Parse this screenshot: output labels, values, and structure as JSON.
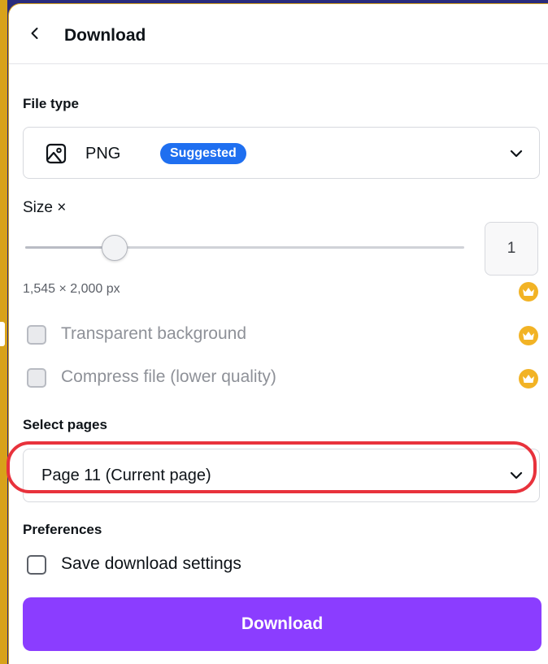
{
  "header": {
    "back_icon": "chevron-left-icon",
    "title": "Download"
  },
  "file_type": {
    "label": "File type",
    "icon": "image-icon",
    "value": "PNG",
    "badge": "Suggested",
    "chevron_icon": "chevron-down-icon"
  },
  "size": {
    "label": "Size ×",
    "slider_value": 1,
    "slider_fraction": 0.2,
    "scale_value": "1",
    "dimensions": "1,545 × 2,000 px",
    "premium_icon": "crown-icon"
  },
  "options": {
    "transparent_label": "Transparent background",
    "transparent_checked": false,
    "compress_label": "Compress file (lower quality)",
    "compress_checked": false
  },
  "pages": {
    "label": "Select pages",
    "value": "Page 11 (Current page)",
    "chevron_icon": "chevron-down-icon"
  },
  "preferences": {
    "label": "Preferences",
    "save_settings_label": "Save download settings",
    "save_settings_checked": false
  },
  "download_button": "Download",
  "colors": {
    "accent": "#8b3dff",
    "badge": "#1f6ff0",
    "premium": "#f2b325",
    "highlight": "#e8323c",
    "background": "#2a2b7c"
  }
}
